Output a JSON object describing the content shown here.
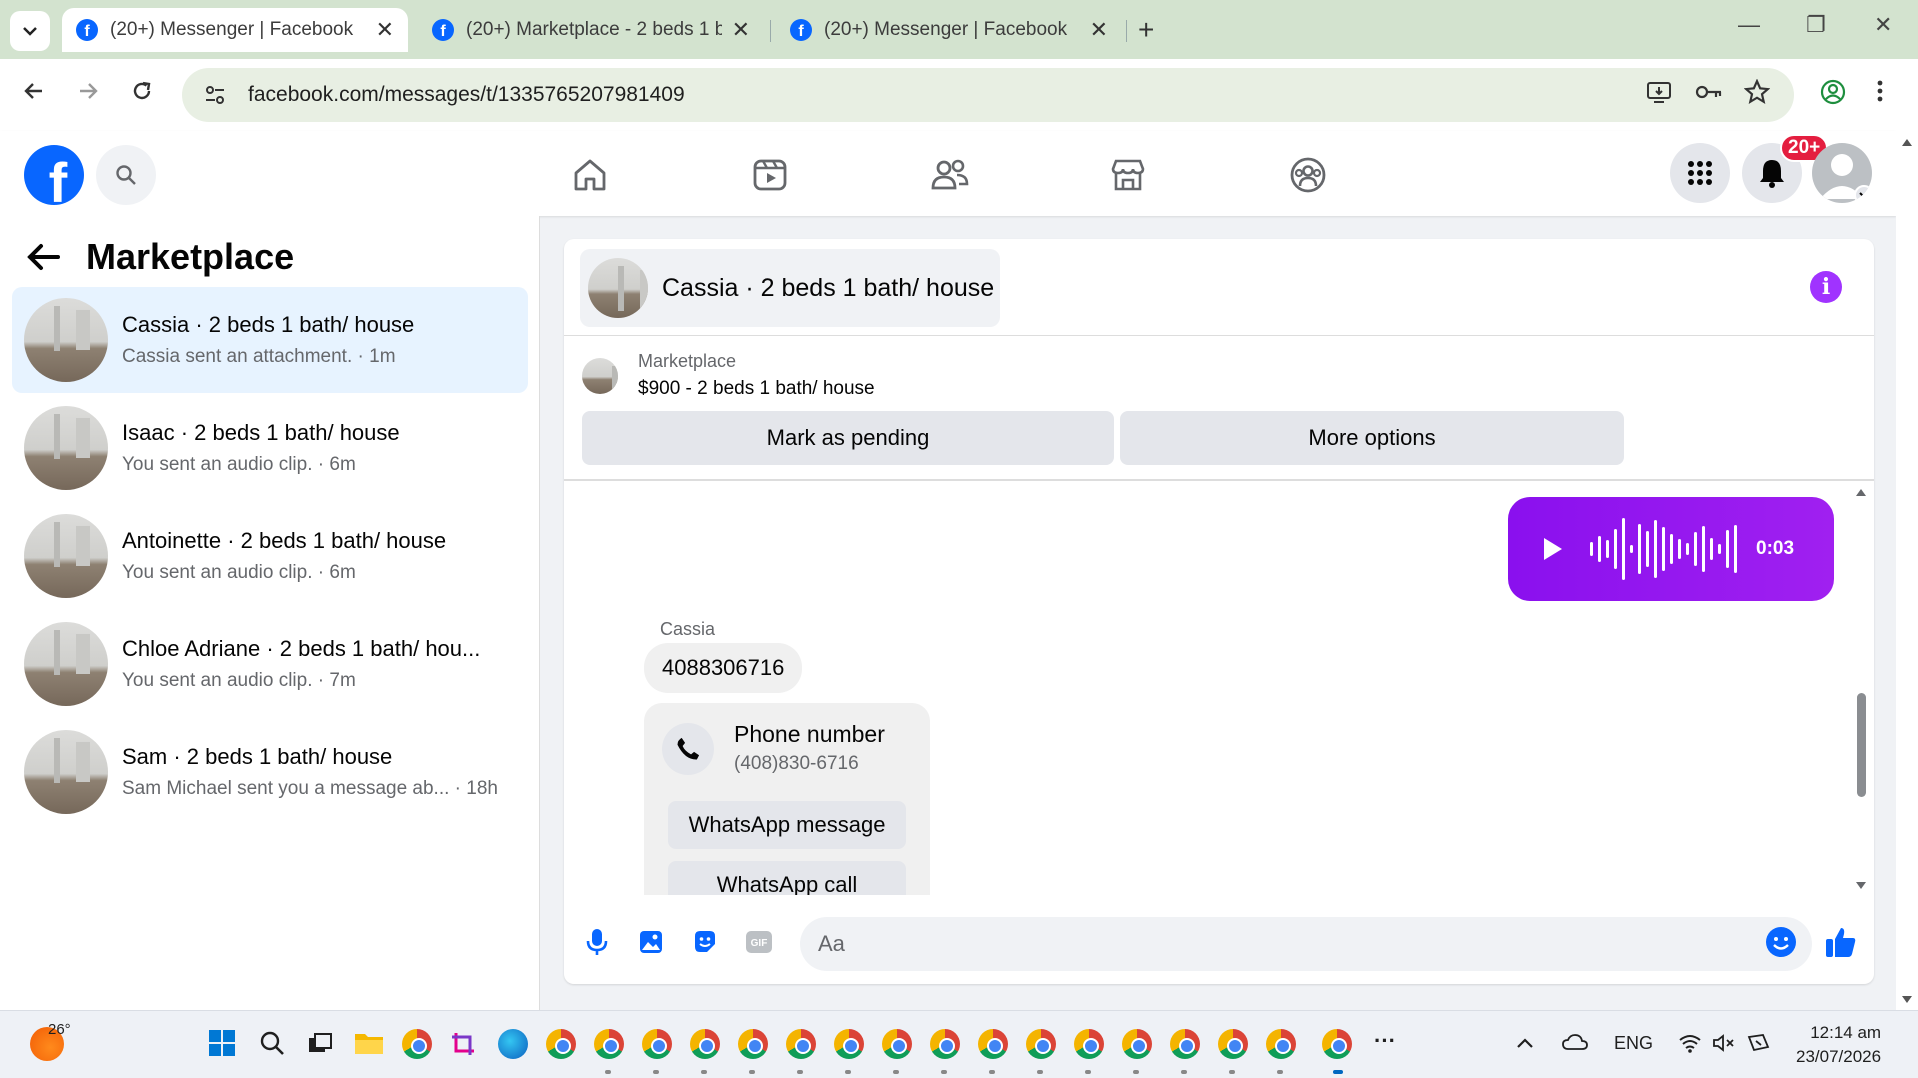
{
  "browser": {
    "tabs": [
      {
        "title": "(20+) Messenger | Facebook",
        "active": true
      },
      {
        "title": "(20+) Marketplace - 2 beds 1 ba",
        "active": false
      },
      {
        "title": "(20+) Messenger | Facebook",
        "active": false
      }
    ],
    "url": "facebook.com/messages/t/1335765207981409"
  },
  "header": {
    "notification_count": "20+"
  },
  "sidebar": {
    "title": "Marketplace",
    "conversations": [
      {
        "name": "Cassia · 2 beds 1 bath/ house",
        "subtitle": "Cassia sent an attachment. · 1m",
        "active": true
      },
      {
        "name": "Isaac · 2 beds 1 bath/ house",
        "subtitle": "You sent an audio clip. · 6m",
        "active": false
      },
      {
        "name": "Antoinette · 2 beds 1 bath/ house",
        "subtitle": "You sent an audio clip. · 6m",
        "active": false
      },
      {
        "name": "Chloe Adriane · 2 beds 1 bath/ hou...",
        "subtitle": "You sent an audio clip. · 7m",
        "active": false
      },
      {
        "name": "Sam · 2 beds 1 bath/ house",
        "subtitle": "Sam Michael sent you a message ab...  · 18h",
        "active": false
      }
    ]
  },
  "chat": {
    "title": "Cassia · 2 beds 1 bath/ house",
    "marketplace_label": "Marketplace",
    "listing": "$900 - 2 beds 1 bath/ house",
    "mark_pending_label": "Mark as pending",
    "more_options_label": "More options",
    "audio_duration": "0:03",
    "sender_name": "Cassia",
    "message_text": "4088306716",
    "card": {
      "title": "Phone number",
      "number": "(408)830-6716",
      "whatsapp_message_label": "WhatsApp message",
      "whatsapp_call_label": "WhatsApp call"
    },
    "input_placeholder": "Aa"
  },
  "taskbar": {
    "temperature": "26°",
    "language": "ENG",
    "time": "12:14 am",
    "date": "23/07/2026"
  },
  "colors": {
    "facebook_blue": "#0866ff",
    "messenger_purple": "#a020f0",
    "active_conversation_bg": "#e7f3ff",
    "notification_red": "#e41e3f"
  }
}
